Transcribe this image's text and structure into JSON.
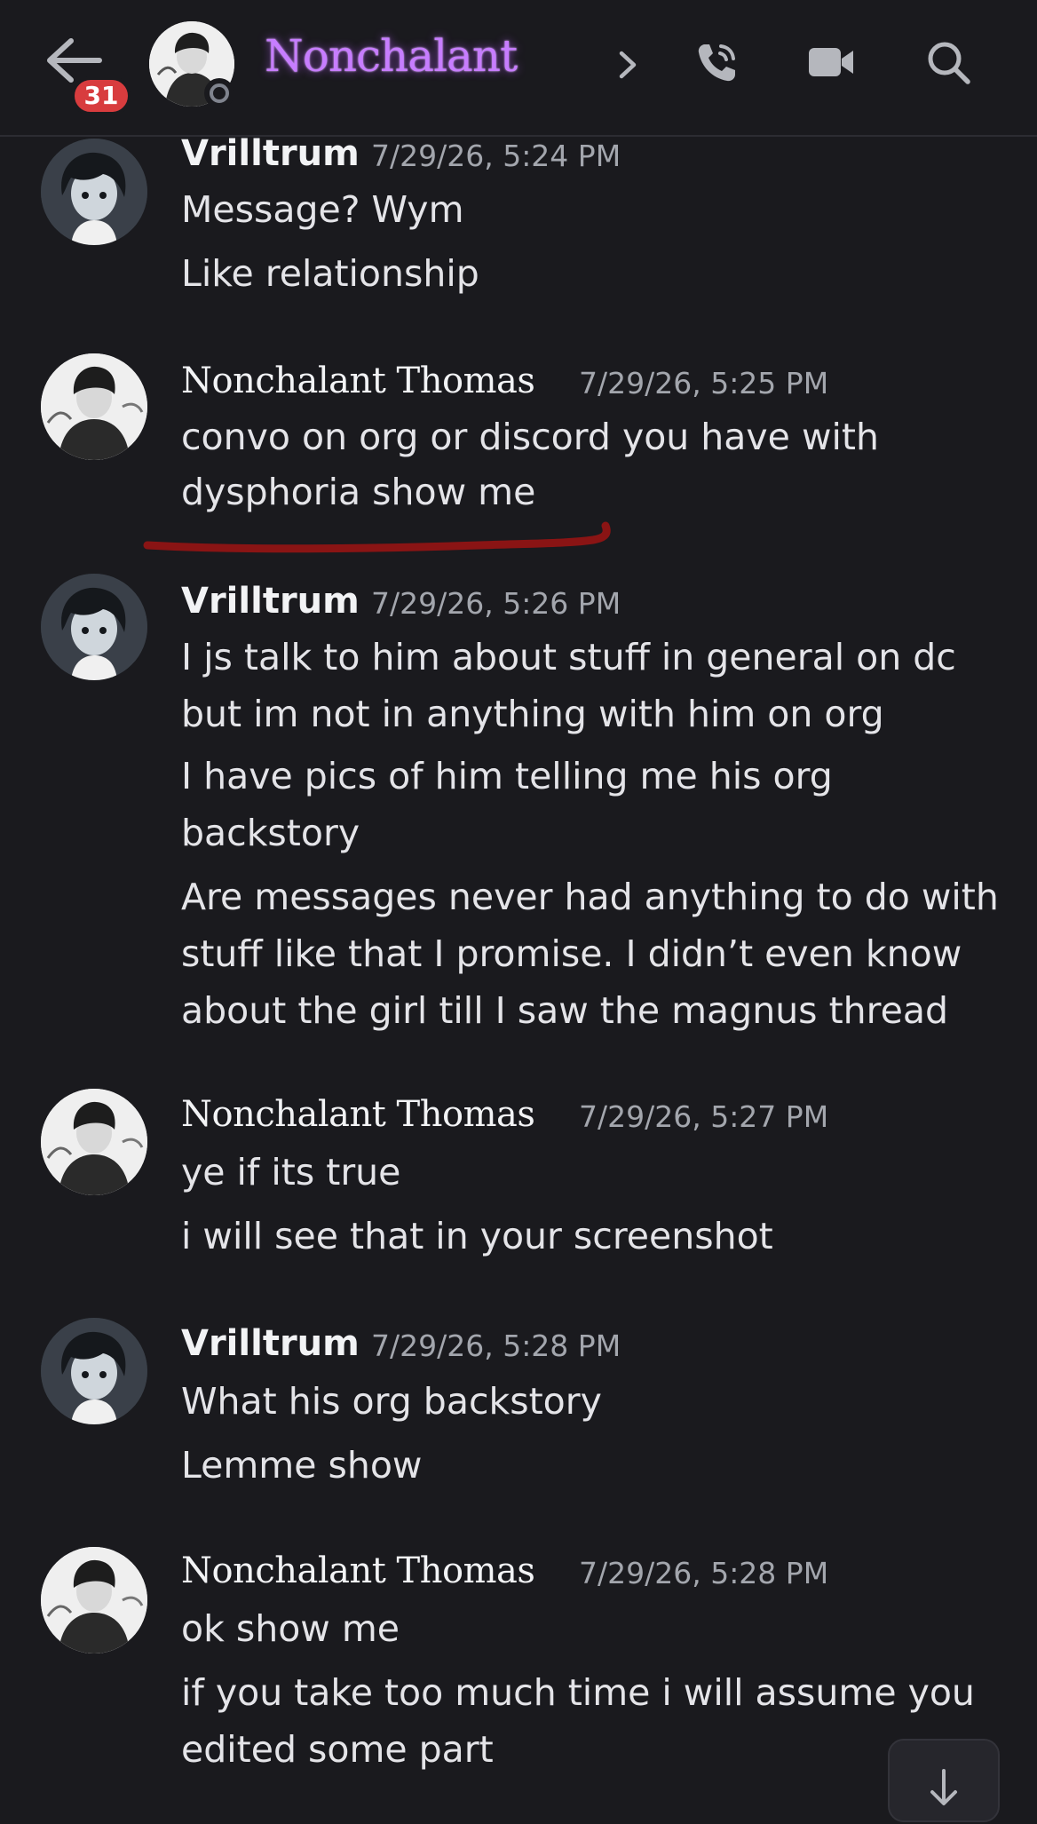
{
  "header": {
    "unread_count": "31",
    "channel_name": "Nonchalant",
    "icons": {
      "back": "back-arrow-icon",
      "chevron": "chevron-right-icon",
      "call": "phone-call-icon",
      "video": "video-camera-icon",
      "search": "search-icon"
    }
  },
  "colors": {
    "background": "#1a1a1e",
    "badge": "#d83c3e",
    "title_glow": "#c77dff",
    "underline": "#8a1414",
    "timestamp": "#a3a6ad"
  },
  "messages": [
    {
      "author": "Vrilltrum",
      "timestamp": "7/29/26, 5:24 PM",
      "lines": [
        "Message? Wym",
        "Like relationship"
      ]
    },
    {
      "author": "Nonchalant Thomas",
      "timestamp": "7/29/26, 5:25 PM",
      "lines": [
        "convo on org or discord you have with",
        "dysphoria show me"
      ]
    },
    {
      "author": "Vrilltrum",
      "timestamp": "7/29/26, 5:26 PM",
      "lines": [
        "I js talk to him about stuff in general on dc",
        "but im not in anything with him on org",
        "I have pics of him telling me his org",
        "backstory",
        "Are messages never had anything to do with",
        "stuff like that I promise. I didn’t even know",
        "about the girl till I saw the magnus thread"
      ]
    },
    {
      "author": "Nonchalant Thomas",
      "timestamp": "7/29/26, 5:27 PM",
      "lines": [
        "ye if its true",
        "i will see that in your screenshot"
      ]
    },
    {
      "author": "Vrilltrum",
      "timestamp": "7/29/26, 5:28 PM",
      "lines": [
        "What his org backstory",
        "Lemme show"
      ]
    },
    {
      "author": "Nonchalant Thomas",
      "timestamp": "7/29/26, 5:28 PM",
      "lines": [
        "ok show me",
        "if you take too much time i will assume you",
        "edited some part"
      ]
    }
  ],
  "scroll_button_icon": "arrow-down-icon"
}
